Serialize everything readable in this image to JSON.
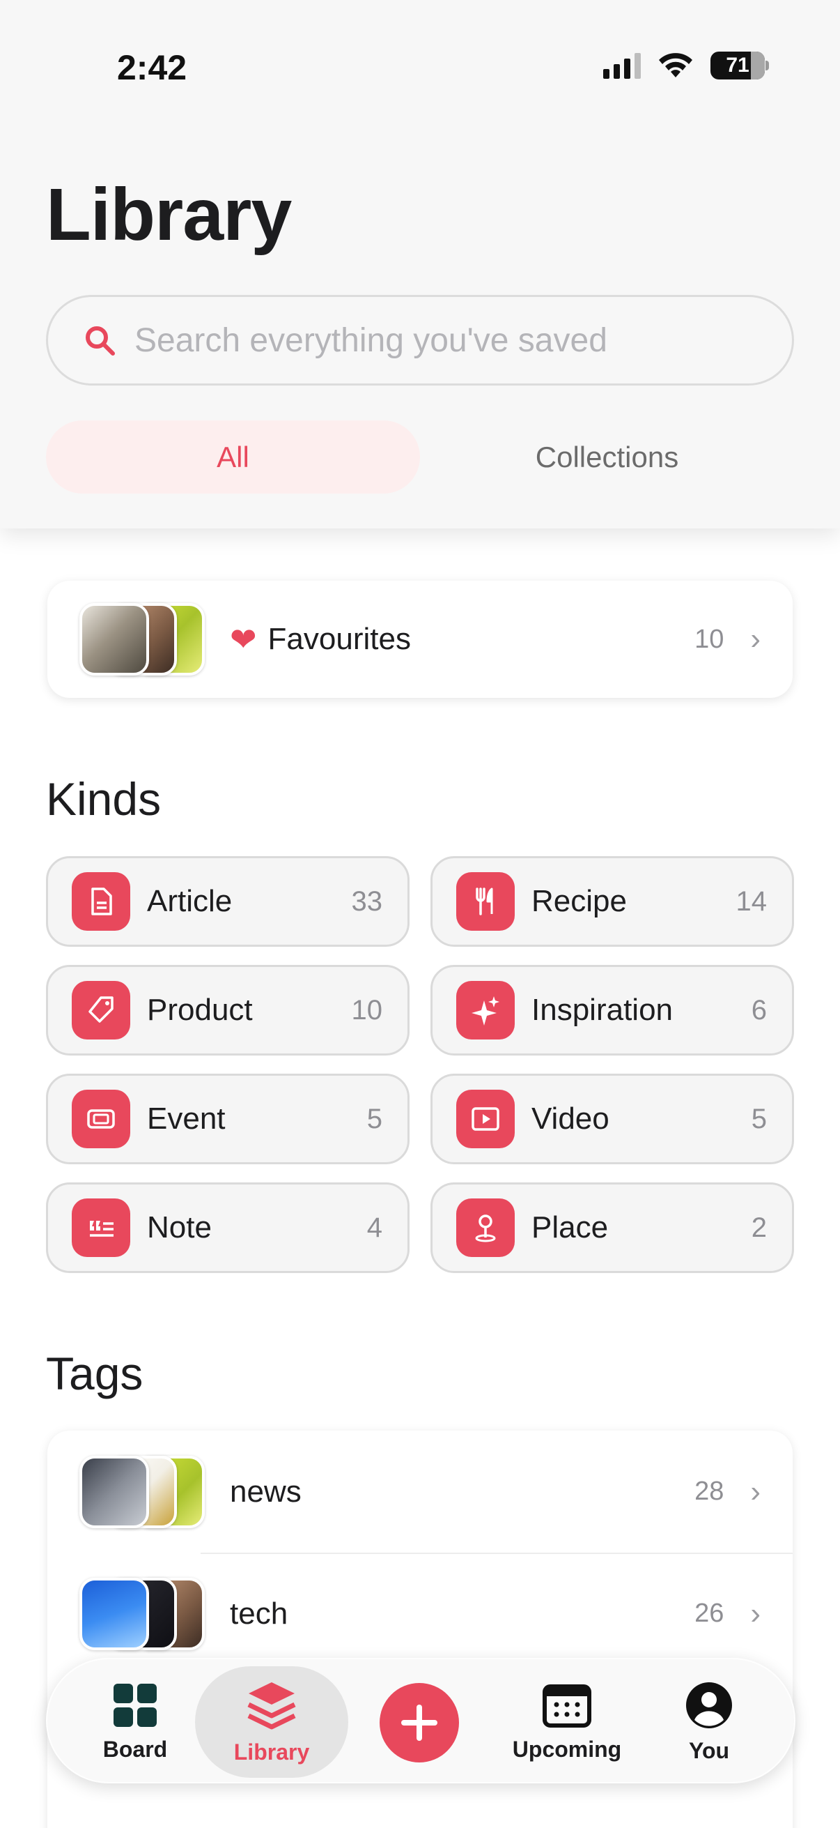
{
  "status_bar": {
    "time": "2:42",
    "battery": "71"
  },
  "header": {
    "title": "Library",
    "search_placeholder": "Search everything you've saved",
    "segments": [
      "All",
      "Collections"
    ],
    "active_segment": "All"
  },
  "favourites": {
    "label": "Favourites",
    "count": "10"
  },
  "kinds": {
    "title": "Kinds",
    "items": [
      {
        "label": "Article",
        "count": "33",
        "icon": "article-icon"
      },
      {
        "label": "Recipe",
        "count": "14",
        "icon": "fork-knife-icon"
      },
      {
        "label": "Product",
        "count": "10",
        "icon": "tag-icon"
      },
      {
        "label": "Inspiration",
        "count": "6",
        "icon": "sparkle-icon"
      },
      {
        "label": "Event",
        "count": "5",
        "icon": "ticket-icon"
      },
      {
        "label": "Video",
        "count": "5",
        "icon": "play-icon"
      },
      {
        "label": "Note",
        "count": "4",
        "icon": "quote-icon"
      },
      {
        "label": "Place",
        "count": "2",
        "icon": "map-pin-icon"
      }
    ]
  },
  "tags": {
    "title": "Tags",
    "items": [
      {
        "label": "news",
        "count": "28"
      },
      {
        "label": "tech",
        "count": "26"
      }
    ]
  },
  "tabbar": {
    "items": [
      {
        "label": "Board",
        "icon": "grid-icon"
      },
      {
        "label": "Library",
        "icon": "layers-icon"
      },
      {
        "label": "Upcoming",
        "icon": "calendar-icon"
      },
      {
        "label": "You",
        "icon": "person-icon"
      }
    ],
    "active": "Library"
  },
  "colors": {
    "accent": "#e8485c",
    "header_bg": "#f7f7f7",
    "segment_active_bg": "#fdeeee"
  }
}
